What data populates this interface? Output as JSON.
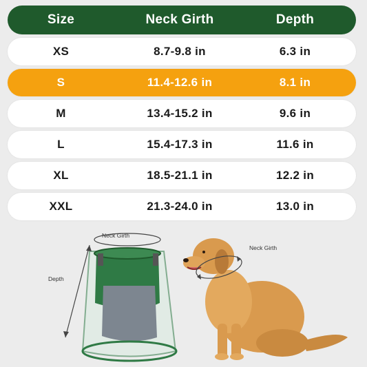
{
  "header": {
    "size": "Size",
    "neck_girth": "Neck Girth",
    "depth": "Depth"
  },
  "rows": [
    {
      "size": "XS",
      "neck_girth": "8.7-9.8 in",
      "depth": "6.3 in"
    },
    {
      "size": "S",
      "neck_girth": "11.4-12.6 in",
      "depth": "8.1 in"
    },
    {
      "size": "M",
      "neck_girth": "13.4-15.2 in",
      "depth": "9.6 in"
    },
    {
      "size": "L",
      "neck_girth": "15.4-17.3 in",
      "depth": "11.6 in"
    },
    {
      "size": "XL",
      "neck_girth": "18.5-21.1 in",
      "depth": "12.2 in"
    },
    {
      "size": "XXL",
      "neck_girth": "21.3-24.0 in",
      "depth": "13.0 in"
    }
  ],
  "diagram": {
    "cone_neck_girth_label": "Neck Girth",
    "cone_depth_label": "Depth",
    "dog_neck_girth_label": "Neck Girth"
  },
  "colors": {
    "header_bg": "#1f5a2c",
    "highlight_row": "#f5a10f",
    "cone_green": "#2f7a45",
    "dog_fur": "#d99a4e"
  }
}
